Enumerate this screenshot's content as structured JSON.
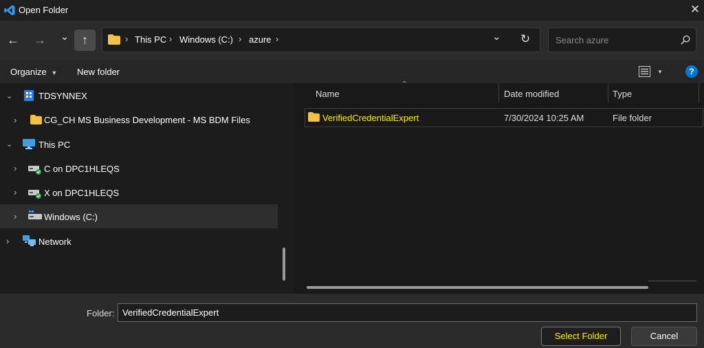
{
  "window": {
    "title": "Open Folder",
    "close_glyph": "✕"
  },
  "nav": {
    "back_glyph": "←",
    "forward_glyph": "→",
    "recent_glyph": "⌄",
    "up_glyph": "↑",
    "breadcrumb": [
      "This PC",
      "Windows (C:)",
      "azure"
    ],
    "sep_glyph": "›",
    "dropdown_glyph": "⌄",
    "refresh_glyph": "↻",
    "search_placeholder": "Search azure",
    "search_icon": "search-icon"
  },
  "toolbar": {
    "organize": "Organize",
    "new_folder": "New folder",
    "help": "?"
  },
  "tree": [
    {
      "label": "TDSYNNEX",
      "icon": "organization-icon",
      "expanded": true
    },
    {
      "label": "CG_CH MS Business Development - MS BDM Files",
      "icon": "folder-icon",
      "expanded": false
    },
    {
      "label": "This PC",
      "icon": "monitor-icon",
      "expanded": true
    },
    {
      "label": "C on DPC1HLEQS",
      "icon": "network-drive-icon",
      "expanded": false
    },
    {
      "label": "X on DPC1HLEQS",
      "icon": "network-drive-icon",
      "expanded": false
    },
    {
      "label": "Windows (C:)",
      "icon": "drive-icon",
      "expanded": false,
      "selected": true
    },
    {
      "label": "Network",
      "icon": "network-icon",
      "expanded": false
    }
  ],
  "columns": [
    "Name",
    "Date modified",
    "Type"
  ],
  "rows": [
    {
      "name": "VerifiedCredentialExpert",
      "date": "7/30/2024 10:25 AM",
      "type": "File folder"
    }
  ],
  "footer": {
    "folder_label": "Folder:",
    "folder_value": "VerifiedCredentialExpert",
    "select_label": "Select Folder",
    "cancel_label": "Cancel"
  },
  "colors": {
    "accent": "#0078d4",
    "highlight": "#ffff00",
    "folder": "#f5c342"
  }
}
